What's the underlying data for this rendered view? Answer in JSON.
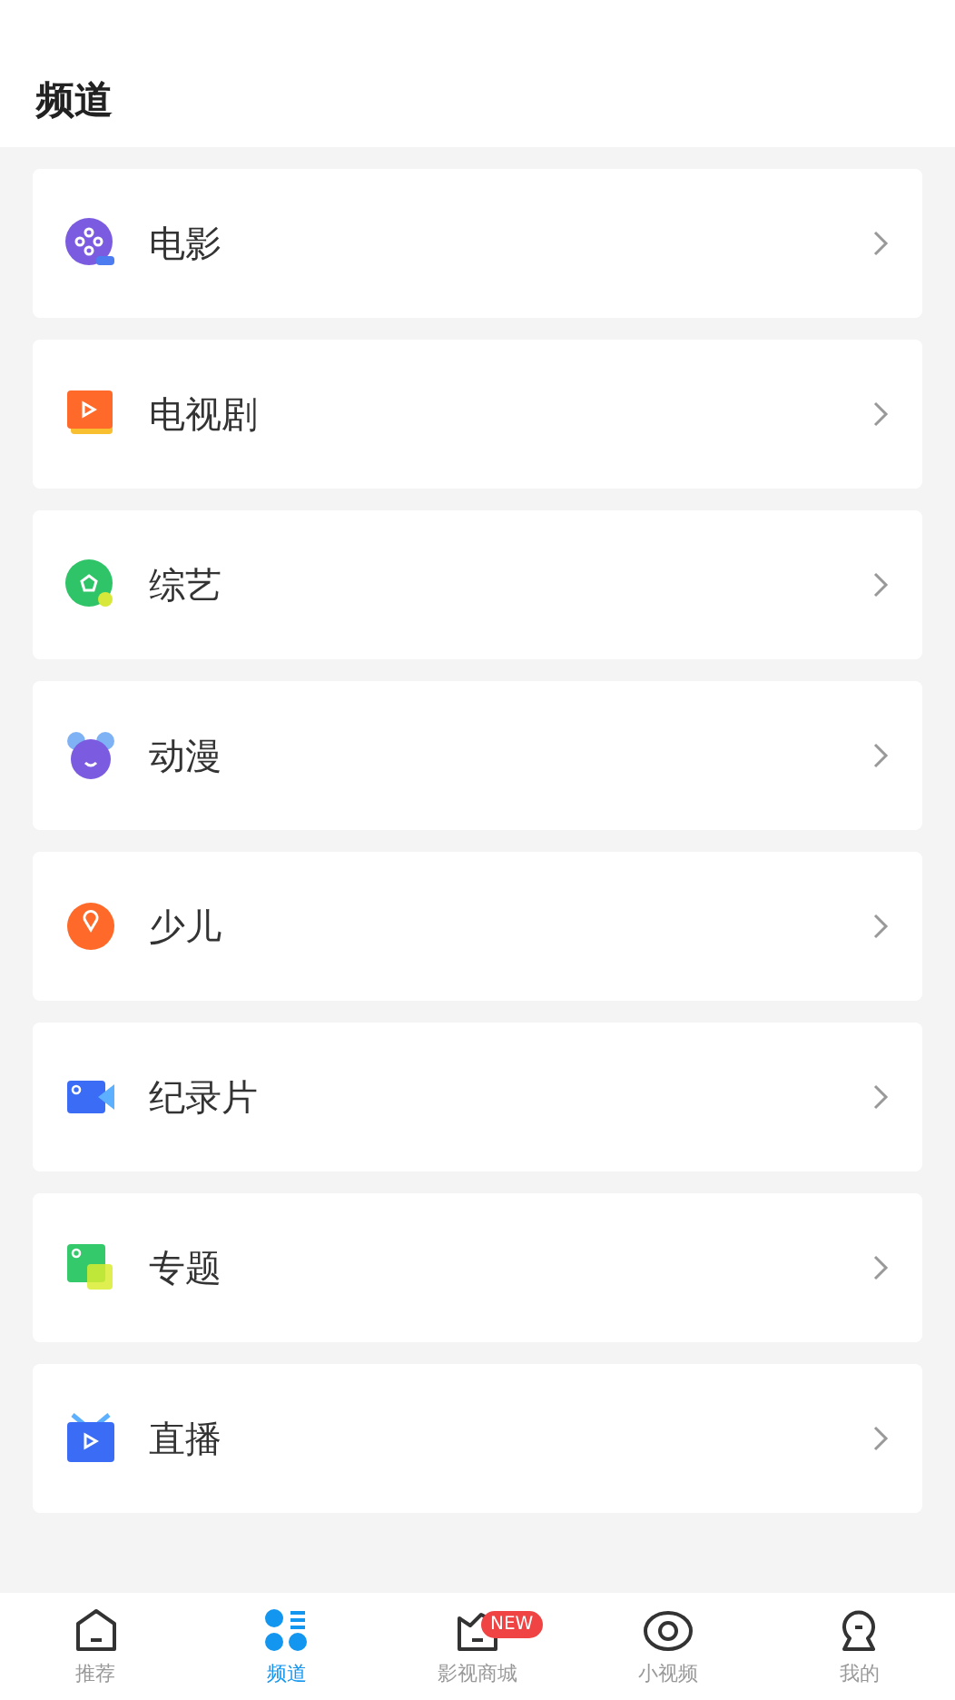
{
  "header": {
    "title": "频道"
  },
  "channels": [
    {
      "label": "电影"
    },
    {
      "label": "电视剧"
    },
    {
      "label": "综艺"
    },
    {
      "label": "动漫"
    },
    {
      "label": "少儿"
    },
    {
      "label": "纪录片"
    },
    {
      "label": "专题"
    },
    {
      "label": "直播"
    }
  ],
  "tab_bar": [
    {
      "label": "推荐",
      "selected": false
    },
    {
      "label": "频道",
      "selected": true
    },
    {
      "label": "影视商城",
      "selected": false,
      "badge": "NEW"
    },
    {
      "label": "小视频",
      "selected": false
    },
    {
      "label": "我的",
      "selected": false
    }
  ]
}
